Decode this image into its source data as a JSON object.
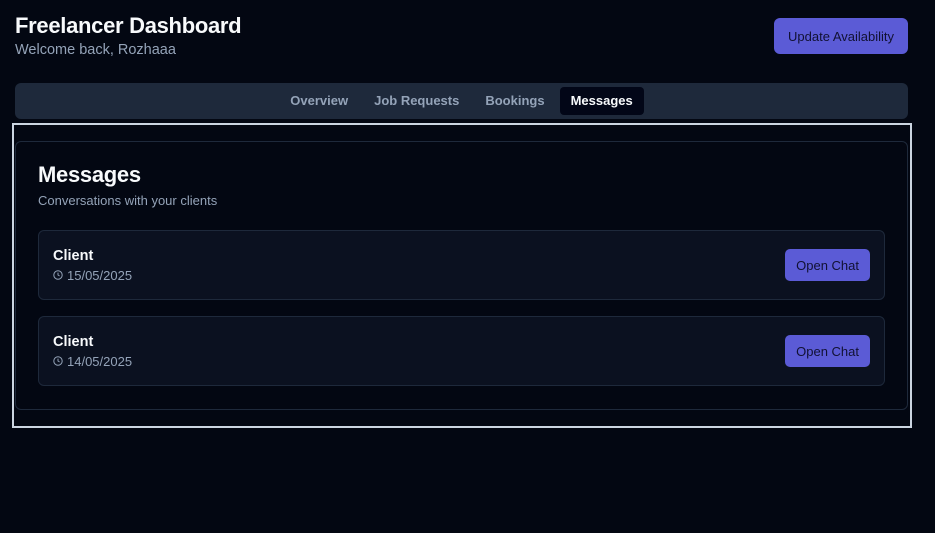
{
  "header": {
    "title": "Freelancer Dashboard",
    "subtitle": "Welcome back, Rozhaaa",
    "update_button": "Update Availability"
  },
  "tabs": [
    {
      "label": "Overview",
      "active": false
    },
    {
      "label": "Job Requests",
      "active": false
    },
    {
      "label": "Bookings",
      "active": false
    },
    {
      "label": "Messages",
      "active": true
    }
  ],
  "messages": {
    "title": "Messages",
    "description": "Conversations with your clients",
    "items": [
      {
        "name": "Client",
        "date": "15/05/2025",
        "icon": "clock-icon",
        "button": "Open Chat"
      },
      {
        "name": "Client",
        "date": "14/05/2025",
        "icon": "clock-icon",
        "button": "Open Chat"
      }
    ]
  },
  "colors": {
    "background": "#030712",
    "accent": "#5b5bd6",
    "tab_bar": "#1e293b"
  }
}
